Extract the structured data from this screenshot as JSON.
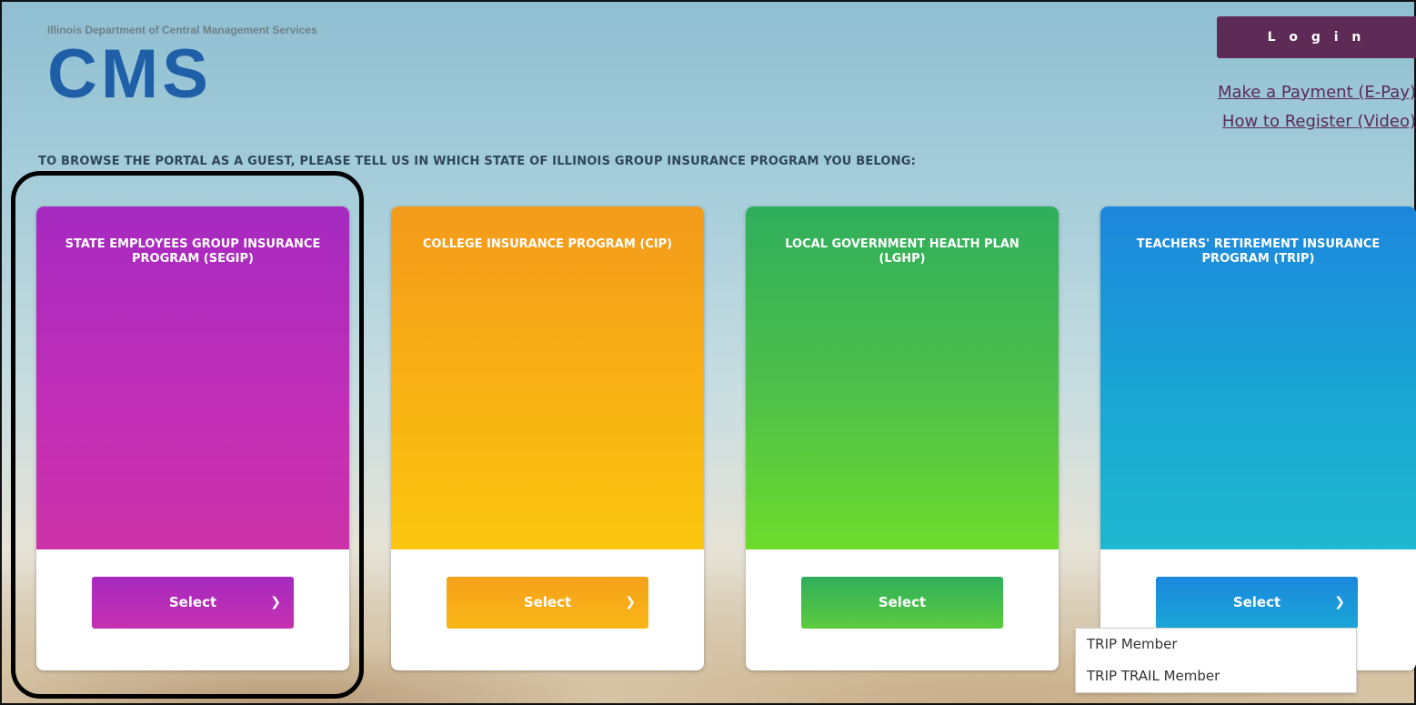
{
  "header": {
    "department": "Illinois Department of Central Management Services",
    "logo_text": "CMS",
    "login_label": "L o g i n",
    "links": {
      "epay": "Make a Payment (E-Pay)",
      "video": "How to Register (Video)"
    }
  },
  "guest_prompt": "TO BROWSE THE PORTAL AS A GUEST, PLEASE TELL US IN WHICH STATE OF ILLINOIS GROUP INSURANCE PROGRAM YOU BELONG:",
  "programs": [
    {
      "title": "STATE EMPLOYEES GROUP INSURANCE PROGRAM (SEGIP)",
      "select_label": "Select",
      "has_dropdown": true,
      "color": "#b82db8"
    },
    {
      "title": "COLLEGE INSURANCE PROGRAM (CIP)",
      "select_label": "Select",
      "has_dropdown": true,
      "color": "#f7a91a"
    },
    {
      "title": "LOCAL GOVERNMENT HEALTH PLAN (LGHP)",
      "select_label": "Select",
      "has_dropdown": false,
      "color": "#3fb853"
    },
    {
      "title": "TEACHERS' RETIREMENT INSURANCE PROGRAM (TRIP)",
      "select_label": "Select",
      "has_dropdown": true,
      "color": "#1b95db"
    }
  ],
  "trip_dropdown": {
    "options": [
      "TRIP Member",
      "TRIP TRAIL Member"
    ]
  },
  "icons": {
    "chevron": "chevron-down-icon"
  }
}
